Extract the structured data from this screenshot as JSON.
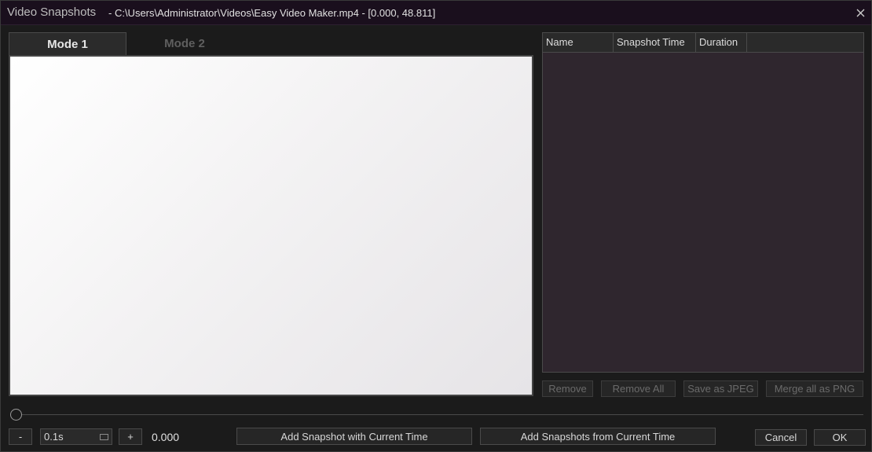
{
  "titlebar": {
    "title": "Video Snapshots",
    "path": "- C:\\Users\\Administrator\\Videos\\Easy Video Maker.mp4 - [0.000, 48.811]"
  },
  "tabs": [
    {
      "label": "Mode 1",
      "active": true
    },
    {
      "label": "Mode 2",
      "active": false
    }
  ],
  "list": {
    "columns": [
      "Name",
      "Snapshot Time",
      "Duration"
    ],
    "rows": []
  },
  "list_buttons": {
    "remove": "Remove",
    "remove_all": "Remove All",
    "save_jpeg": "Save as JPEG",
    "merge_png": "Merge all as PNG"
  },
  "controls": {
    "minus": "-",
    "step_value": "0.1s",
    "plus": "+",
    "current_time": "0.000",
    "slider_position": 0
  },
  "actions": {
    "add_snapshot": "Add Snapshot with Current Time",
    "add_snapshots": "Add Snapshots from Current Time",
    "cancel": "Cancel",
    "ok": "OK"
  },
  "colors": {
    "titlebar_bg": "#1a0f1d",
    "list_bg": "#2f262e",
    "window_bg": "#1b1b1b"
  },
  "icons": {
    "close": "close-icon",
    "spin": "spin-icon"
  }
}
